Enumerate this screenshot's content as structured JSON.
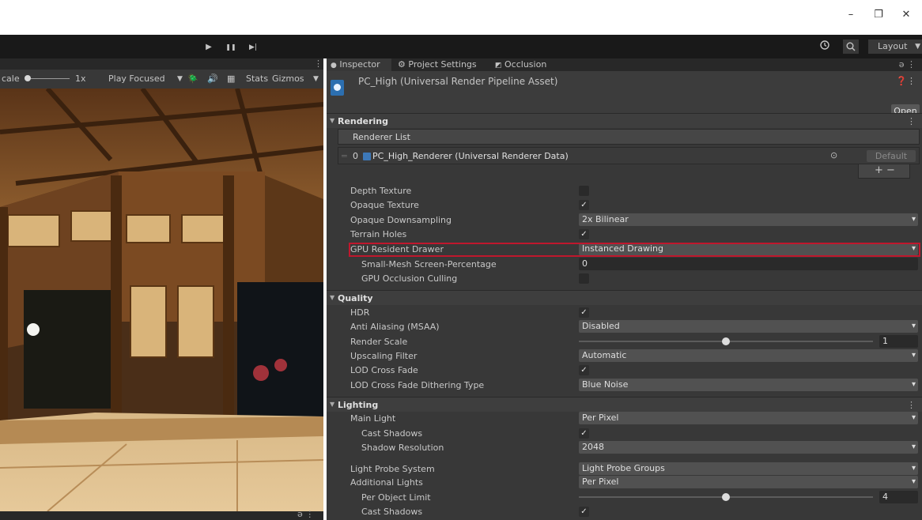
{
  "window": {
    "minimize_glyph": "–",
    "restore_glyph": "❐",
    "close_glyph": "✕"
  },
  "toolbar": {
    "play_glyph": "▶",
    "pause_glyph": "❚❚",
    "step_glyph": "▶|",
    "history_icon": "history-icon",
    "search_icon": "search-icon",
    "layout_label": "Layout"
  },
  "game": {
    "scale_label": "cale",
    "scale_value": "1x",
    "play_mode": "Play Focused",
    "stats_label": "Stats",
    "gizmos_label": "Gizmos"
  },
  "inspector": {
    "tabs": [
      {
        "label": "Inspector",
        "icon": "info-icon"
      },
      {
        "label": "Project Settings",
        "icon": "gear-icon"
      },
      {
        "label": "Occlusion",
        "icon": "occlusion-icon"
      }
    ],
    "asset_title": "PC_High (Universal Render Pipeline Asset)",
    "open_label": "Open",
    "rendering": {
      "title": "Rendering",
      "renderer_list_label": "Renderer List",
      "renderer_index": "0",
      "renderer_name": "PC_High_Renderer (Universal Renderer Data)",
      "default_label": "Default",
      "add_remove": "+   −",
      "depth_texture": "Depth Texture",
      "opaque_texture": "Opaque Texture",
      "opaque_downsampling": "Opaque Downsampling",
      "opaque_downsampling_value": "2x Bilinear",
      "terrain_holes": "Terrain Holes",
      "gpu_resident_drawer": "GPU Resident Drawer",
      "gpu_resident_drawer_value": "Instanced Drawing",
      "small_mesh": "Small-Mesh Screen-Percentage",
      "small_mesh_value": "0",
      "gpu_occlusion": "GPU Occlusion Culling"
    },
    "quality": {
      "title": "Quality",
      "hdr": "HDR",
      "anti_aliasing": "Anti Aliasing (MSAA)",
      "anti_aliasing_value": "Disabled",
      "render_scale": "Render Scale",
      "render_scale_value": "1",
      "upscaling_filter": "Upscaling Filter",
      "upscaling_filter_value": "Automatic",
      "lod_cross_fade": "LOD Cross Fade",
      "lod_dither": "LOD Cross Fade Dithering Type",
      "lod_dither_value": "Blue Noise"
    },
    "lighting": {
      "title": "Lighting",
      "main_light": "Main Light",
      "main_light_value": "Per Pixel",
      "cast_shadows": "Cast Shadows",
      "shadow_resolution": "Shadow Resolution",
      "shadow_resolution_value": "2048",
      "light_probe_system": "Light Probe System",
      "light_probe_system_value": "Light Probe Groups",
      "additional_lights": "Additional Lights",
      "additional_lights_value": "Per Pixel",
      "per_object_limit": "Per Object Limit",
      "per_object_limit_value": "4",
      "cast_shadows_2": "Cast Shadows"
    }
  },
  "sliders": {
    "render_scale_fraction": 0.5,
    "per_object_limit_fraction": 0.5
  },
  "checkboxes": {
    "depth_texture": false,
    "opaque_texture": true,
    "terrain_holes": true,
    "gpu_occlusion": false,
    "hdr": true,
    "lod_cross_fade": true,
    "cast_shadows": true,
    "cast_shadows_2": true
  },
  "colors": {
    "highlight": "#c0172d",
    "panel": "#383838",
    "toolbar": "#191919"
  }
}
